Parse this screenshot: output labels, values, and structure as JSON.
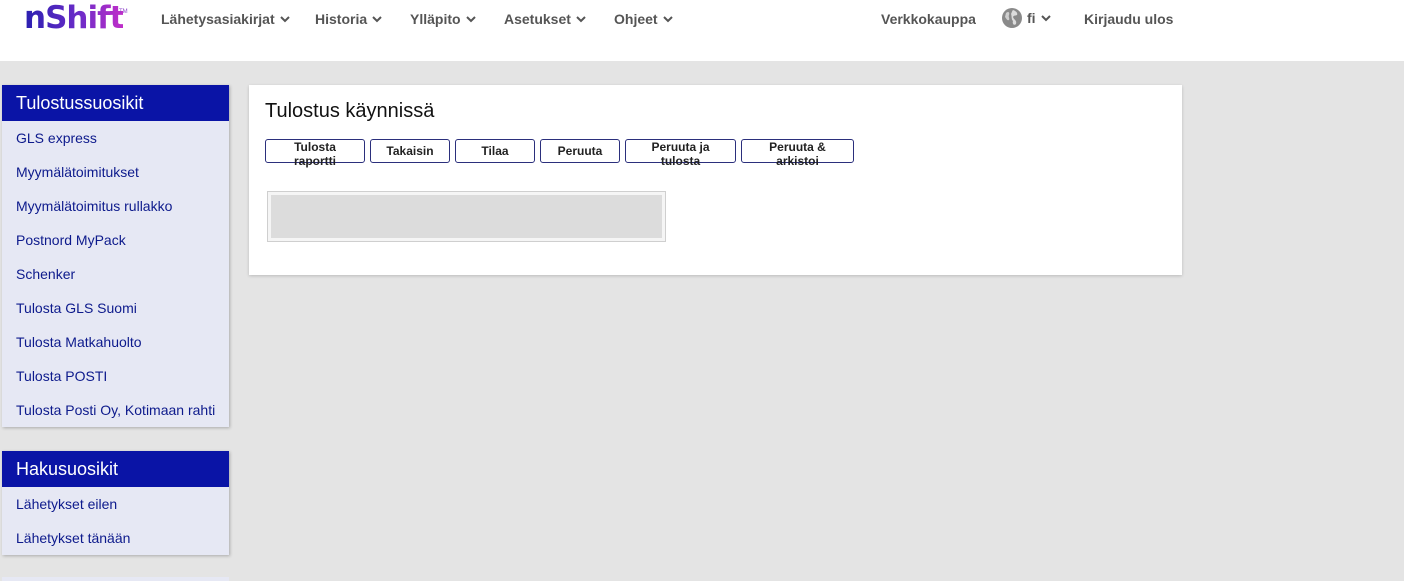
{
  "header": {
    "logo": "nShift",
    "logo_tm": "TM",
    "nav": [
      {
        "label": "Lähetysasiakirjat"
      },
      {
        "label": "Historia"
      },
      {
        "label": "Ylläpito"
      },
      {
        "label": "Asetukset"
      },
      {
        "label": "Ohjeet"
      }
    ],
    "shop_label": "Verkkokauppa",
    "language": "fi",
    "logout_label": "Kirjaudu ulos"
  },
  "sidebar": {
    "print_favorites": {
      "title": "Tulostussuosikit",
      "items": [
        "GLS express",
        "Myymälätoimitukset",
        "Myymälätoimitus rullakko",
        "Postnord MyPack",
        "Schenker",
        "Tulosta GLS Suomi",
        "Tulosta Matkahuolto",
        "Tulosta POSTI",
        "Tulosta Posti Oy, Kotimaan rahti"
      ]
    },
    "search_favorites": {
      "title": "Hakusuosikit",
      "items": [
        "Lähetykset eilen",
        "Lähetykset tänään"
      ]
    }
  },
  "main": {
    "title": "Tulostus käynnissä",
    "buttons": [
      "Tulosta raportti",
      "Takaisin",
      "Tilaa",
      "Peruuta",
      "Peruuta ja tulosta",
      "Peruuta & arkistoi"
    ],
    "progress": 0
  },
  "colors": {
    "sidebar_header": "#0a14a6",
    "sidebar_bg": "#e6e8f4",
    "link": "#0d1a8c",
    "page_bg": "#e4e4e4"
  }
}
